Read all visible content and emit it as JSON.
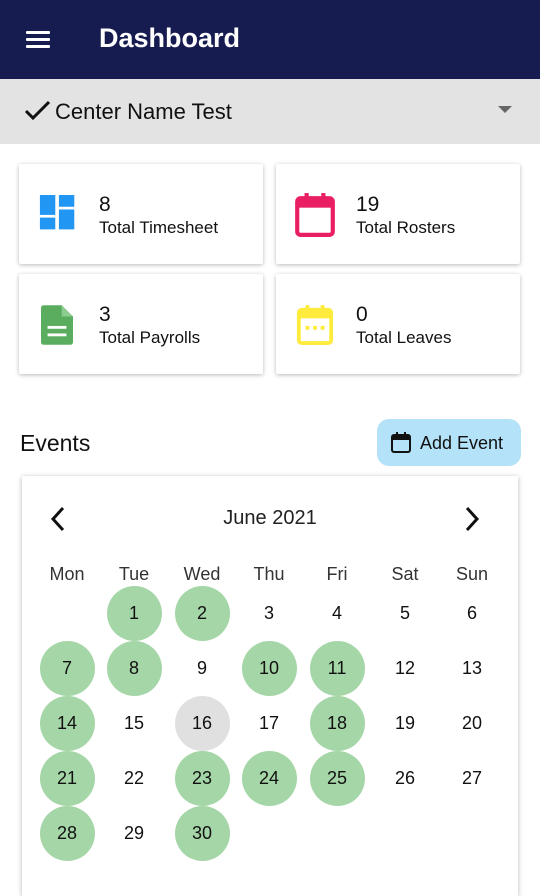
{
  "app_bar": {
    "title": "Dashboard"
  },
  "center_selector": {
    "selected": "Center Name Test"
  },
  "stats": [
    {
      "count": "8",
      "label": "Total Timesheet",
      "icon": "dashboard-grid-icon",
      "color": "#2196f3"
    },
    {
      "count": "19",
      "label": "Total Rosters",
      "icon": "calendar-icon",
      "color": "#e91e63"
    },
    {
      "count": "3",
      "label": "Total Payrolls",
      "icon": "document-icon",
      "color": "#4caf50"
    },
    {
      "count": "0",
      "label": "Total Leaves",
      "icon": "calendar-dots-icon",
      "color": "#ffeb3b"
    }
  ],
  "events": {
    "title": "Events",
    "add_button_label": "Add Event"
  },
  "calendar": {
    "month_label": "June 2021",
    "weekdays": [
      "Mon",
      "Tue",
      "Wed",
      "Thu",
      "Fri",
      "Sat",
      "Sun"
    ],
    "days": [
      {
        "d": "1",
        "s": "event"
      },
      {
        "d": "2",
        "s": "event"
      },
      {
        "d": "3",
        "s": ""
      },
      {
        "d": "4",
        "s": ""
      },
      {
        "d": "5",
        "s": ""
      },
      {
        "d": "6",
        "s": ""
      },
      {
        "d": "7",
        "s": "event"
      },
      {
        "d": "8",
        "s": "event"
      },
      {
        "d": "9",
        "s": ""
      },
      {
        "d": "10",
        "s": "event"
      },
      {
        "d": "11",
        "s": "event"
      },
      {
        "d": "12",
        "s": ""
      },
      {
        "d": "13",
        "s": ""
      },
      {
        "d": "14",
        "s": "event"
      },
      {
        "d": "15",
        "s": ""
      },
      {
        "d": "16",
        "s": "today"
      },
      {
        "d": "17",
        "s": ""
      },
      {
        "d": "18",
        "s": "event"
      },
      {
        "d": "19",
        "s": ""
      },
      {
        "d": "20",
        "s": ""
      },
      {
        "d": "21",
        "s": "event"
      },
      {
        "d": "22",
        "s": ""
      },
      {
        "d": "23",
        "s": "event"
      },
      {
        "d": "24",
        "s": "event"
      },
      {
        "d": "25",
        "s": "event"
      },
      {
        "d": "26",
        "s": ""
      },
      {
        "d": "27",
        "s": ""
      },
      {
        "d": "28",
        "s": "event"
      },
      {
        "d": "29",
        "s": ""
      },
      {
        "d": "30",
        "s": "event"
      }
    ]
  }
}
